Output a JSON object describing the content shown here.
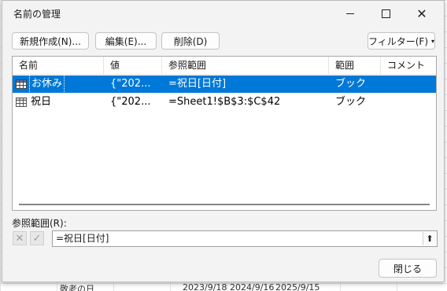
{
  "dialog": {
    "title": "名前の管理",
    "window_controls": {
      "minimize": "minimize-icon",
      "maximize": "maximize-icon",
      "close": "✕"
    }
  },
  "toolbar": {
    "new_label": "新規作成(N)...",
    "edit_label": "編集(E)...",
    "delete_label": "削除(D)",
    "filter_label": "フィルター(F)",
    "filter_caret": "▾"
  },
  "list": {
    "columns": [
      "名前",
      "値",
      "参照範囲",
      "範囲",
      "コメント"
    ],
    "rows": [
      {
        "name": "お休み",
        "value": "{\"202...",
        "refers_to": "=祝日[日付]",
        "scope": "ブック",
        "comment": "",
        "selected": true,
        "icon": "table-icon"
      },
      {
        "name": "祝日",
        "value": "{\"202...",
        "refers_to": "=Sheet1!$B$3:$C$42",
        "scope": "ブック",
        "comment": "",
        "selected": false,
        "icon": "table-icon"
      }
    ]
  },
  "reference": {
    "label": "参照範囲(R):",
    "value": "=祝日[日付]",
    "cancel_glyph": "✕",
    "ok_glyph": "✓",
    "collapse_glyph": "⬆"
  },
  "close_button": "閉じる",
  "background_sheet": {
    "peek_text": [
      "敬老の日",
      "2023/9/18",
      "2024/9/16",
      "2025/9/15"
    ]
  },
  "colors": {
    "selection": "#0078d7",
    "dialog_bg": "#f3f3f3"
  }
}
